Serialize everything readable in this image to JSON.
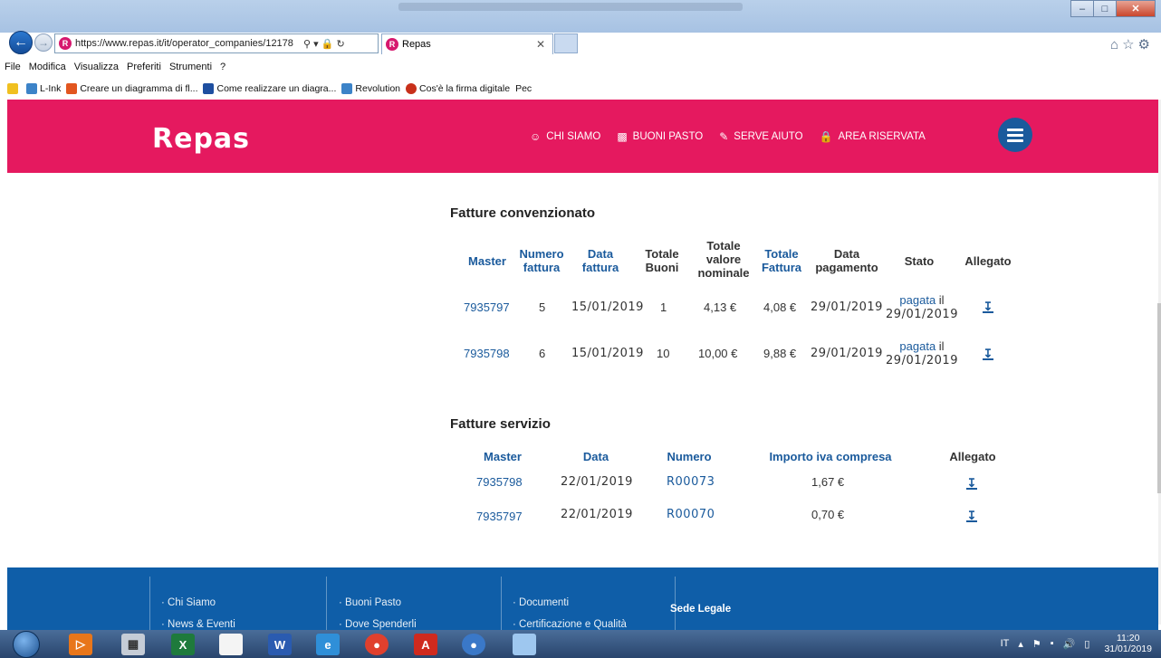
{
  "browser": {
    "url": "https://www.repas.it/it/operator_companies/12178",
    "url_host_bold": "www.repas.it",
    "tab_title": "Repas",
    "menu": [
      "File",
      "Modifica",
      "Visualizza",
      "Preferiti",
      "Strumenti",
      "?"
    ],
    "favorites": [
      "L-Ink",
      "Creare un diagramma di fl...",
      "Come realizzare un diagra...",
      "Revolution",
      "Cos'è la firma digitale",
      "Pec"
    ]
  },
  "header": {
    "logo": "Repas",
    "nav": [
      {
        "label": "CHI SIAMO",
        "icon": "user-icon"
      },
      {
        "label": "BUONI PASTO",
        "icon": "ticket-icon"
      },
      {
        "label": "SERVE AIUTO",
        "icon": "pencil-icon"
      },
      {
        "label": "AREA RISERVATA",
        "icon": "lock-icon"
      }
    ]
  },
  "fatture_convenzionato": {
    "title": "Fatture convenzionato",
    "columns": [
      "Master",
      "Numero fattura",
      "Data fattura",
      "Totale Buoni",
      "Totale valore nominale",
      "Totale Fattura",
      "Data pagamento",
      "Stato",
      "Allegato"
    ],
    "rows": [
      {
        "master": "7935797",
        "numero": "5",
        "data": "15/01/2019",
        "buoni": "1",
        "valore": "4,13 €",
        "fattura": "4,08 €",
        "pagamento": "29/01/2019",
        "stato_link": "pagata",
        "stato_rest": "il",
        "stato_date": "29/01/2019"
      },
      {
        "master": "7935798",
        "numero": "6",
        "data": "15/01/2019",
        "buoni": "10",
        "valore": "10,00 €",
        "fattura": "9,88 €",
        "pagamento": "29/01/2019",
        "stato_link": "pagata",
        "stato_rest": "il",
        "stato_date": "29/01/2019"
      }
    ]
  },
  "fatture_servizio": {
    "title": "Fatture servizio",
    "columns": [
      "Master",
      "Data",
      "Numero",
      "Importo iva compresa",
      "Allegato"
    ],
    "rows": [
      {
        "master": "7935798",
        "data": "22/01/2019",
        "numero": "R00073",
        "importo": "1,67 €"
      },
      {
        "master": "7935797",
        "data": "22/01/2019",
        "numero": "R00070",
        "importo": "0,70 €"
      }
    ]
  },
  "footer": {
    "col1": [
      "Chi Siamo",
      "News & Eventi"
    ],
    "col2": [
      "Buoni Pasto",
      "Dove Spenderli"
    ],
    "col3": [
      "Documenti",
      "Certificazione e Qualità"
    ],
    "sede": "Sede Legale"
  },
  "taskbar": {
    "lang": "IT",
    "time": "11:20",
    "date": "31/01/2019"
  },
  "colors": {
    "brand_pink": "#e5195f",
    "brand_blue": "#1a5a9c",
    "footer_blue": "#0f5ea8"
  }
}
